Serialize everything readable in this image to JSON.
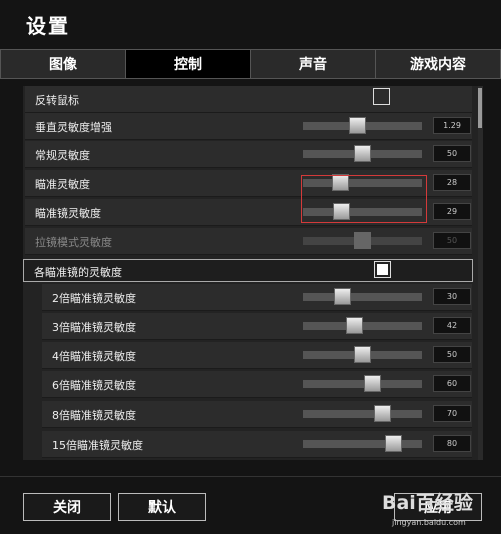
{
  "title": "设置",
  "tabs": [
    "图像",
    "控制",
    "声音",
    "游戏内容"
  ],
  "active_tab": "控制",
  "rows": {
    "invert_mouse": {
      "label": "反转鼠标",
      "checked": false
    },
    "vertical_sens": {
      "label": "垂直灵敏度增强",
      "value": "1.29",
      "fraction": 0.45
    },
    "normal_sens": {
      "label": "常规灵敏度",
      "value": "50",
      "fraction": 0.5
    },
    "aim_sens": {
      "label": "瞄准灵敏度",
      "value": "28",
      "fraction": 0.28
    },
    "scope_sens": {
      "label": "瞄准镜灵敏度",
      "value": "29",
      "fraction": 0.29
    },
    "zoom_mode_sens": {
      "label": "拉镜模式灵敏度",
      "value": "50",
      "fraction": 0.5,
      "disabled": true
    },
    "per_scope": {
      "label": "各瞄准镜的灵敏度",
      "checked": true
    },
    "scope_2x": {
      "label": "2倍瞄准镜灵敏度",
      "value": "30",
      "fraction": 0.3
    },
    "scope_3x": {
      "label": "3倍瞄准镜灵敏度",
      "value": "42",
      "fraction": 0.42
    },
    "scope_4x": {
      "label": "4倍瞄准镜灵敏度",
      "value": "50",
      "fraction": 0.5
    },
    "scope_6x": {
      "label": "6倍瞄准镜灵敏度",
      "value": "60",
      "fraction": 0.6
    },
    "scope_8x": {
      "label": "8倍瞄准镜灵敏度",
      "value": "70",
      "fraction": 0.7
    },
    "scope_15x": {
      "label": "15倍瞄准镜灵敏度",
      "value": "80",
      "fraction": 0.8
    }
  },
  "footer": {
    "close_label": "关闭",
    "default_label": "默认",
    "apply_label": "应用"
  },
  "watermark": {
    "brand": "Bai百经验",
    "url": "jingyan.baidu.com"
  }
}
